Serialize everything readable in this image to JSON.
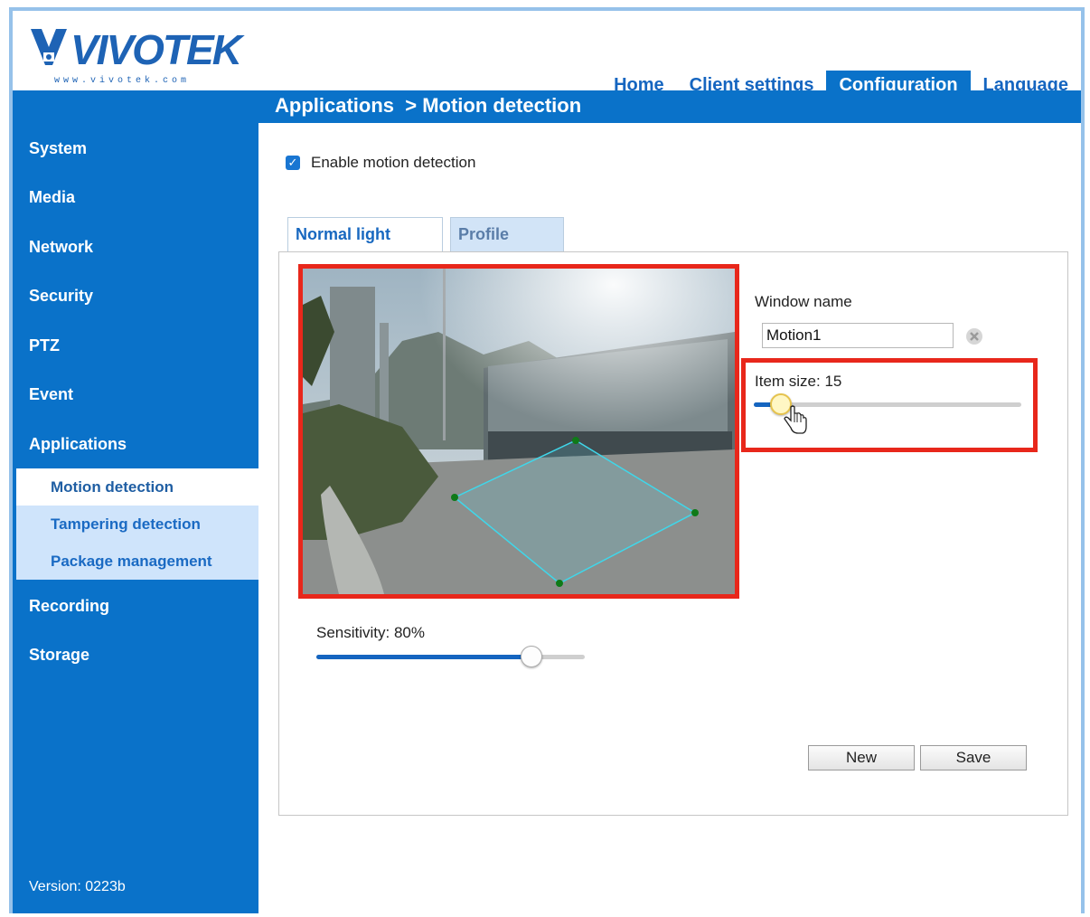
{
  "header": {
    "brand": "VIVOTEK",
    "brand_url": "www.vivotek.com",
    "nav": [
      {
        "label": "Home"
      },
      {
        "label": "Client settings"
      },
      {
        "label": "Configuration",
        "active": true
      },
      {
        "label": "Language"
      }
    ],
    "accent_color": "#0a72c9"
  },
  "breadcrumb": "Applications  > Motion detection",
  "sidebar": {
    "items": [
      {
        "label": "System"
      },
      {
        "label": "Media"
      },
      {
        "label": "Network"
      },
      {
        "label": "Security"
      },
      {
        "label": "PTZ"
      },
      {
        "label": "Event"
      },
      {
        "label": "Applications"
      },
      {
        "label": "Recording"
      },
      {
        "label": "Storage"
      }
    ],
    "submenu": [
      {
        "label": "Motion detection",
        "active": true
      },
      {
        "label": "Tampering detection"
      },
      {
        "label": "Package management"
      }
    ],
    "version": "Version: 0223b"
  },
  "main": {
    "enable_checkbox": {
      "label": "Enable motion detection",
      "checked": true
    },
    "mode_tabs": [
      {
        "label": "Normal light mode",
        "active": true
      },
      {
        "label": "Profile mode"
      }
    ],
    "window_name_label": "Window name",
    "window_name_value": "Motion1",
    "item_size_label": "Item size: 15",
    "item_size_fraction": 0.1,
    "sensitivity_label": "Sensitivity: 80%",
    "sensitivity_fraction": 0.8,
    "buttons": {
      "new": "New",
      "save": "Save"
    },
    "highlight_color": "#e8271b",
    "detection_window_color": "#33d0e0"
  }
}
